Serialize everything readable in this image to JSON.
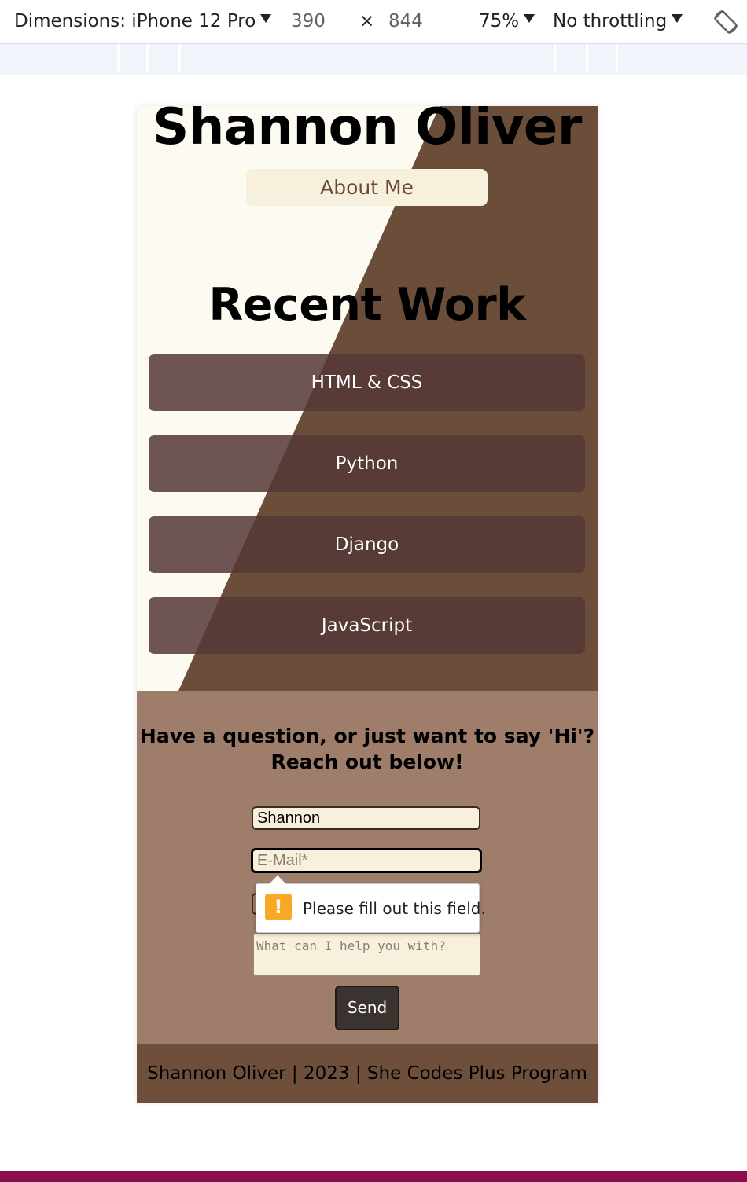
{
  "devtools": {
    "device_label": "Dimensions: iPhone 12 Pro",
    "width": "390",
    "times": "×",
    "height": "844",
    "zoom": "75%",
    "throttling": "No throttling",
    "rotate_icon": "rotate-icon"
  },
  "site": {
    "name": "Shannon Oliver",
    "about_label": "About Me",
    "recent_title": "Recent Work",
    "work_buttons": [
      "HTML & CSS",
      "Python",
      "Django",
      "JavaScript"
    ]
  },
  "contact": {
    "heading_line1": "Have a question, or just want to say 'Hi'?",
    "heading_line2": "Reach out below!",
    "name_value": "Shannon",
    "email_placeholder": "E-Mail*",
    "message_placeholder": "What can I help you with?",
    "send_label": "Send",
    "validation_message": "Please fill out this field.",
    "warning_icon": "!"
  },
  "footer": {
    "text": "Shannon Oliver | 2023 | She Codes Plus Program"
  },
  "colors": {
    "cream": "#fdfaf2",
    "brown": "#6b4e3a",
    "button": "#5a3d3b",
    "contact_bg": "#9f7d6b",
    "footer_bg": "#6e4f3c"
  }
}
